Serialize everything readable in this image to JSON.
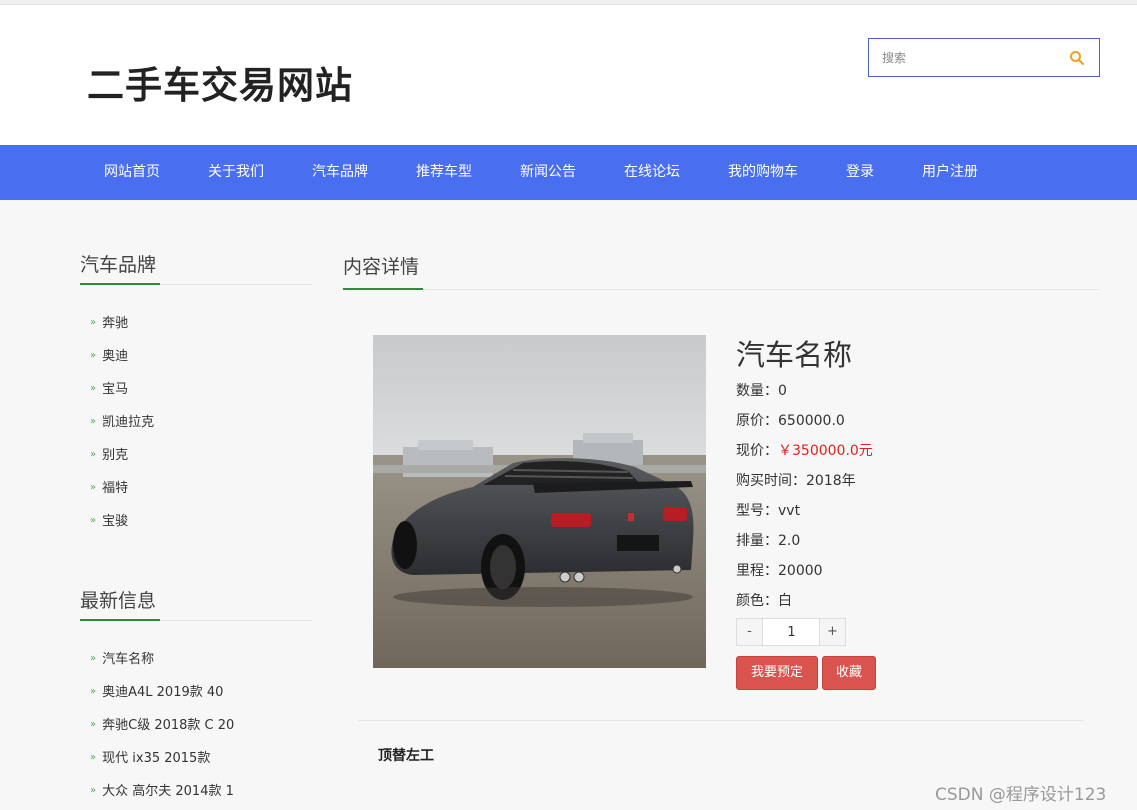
{
  "site": {
    "title": "二手车交易网站"
  },
  "search": {
    "placeholder": "搜索",
    "icon": "search-icon"
  },
  "nav": {
    "items": [
      {
        "label": "网站首页"
      },
      {
        "label": "关于我们"
      },
      {
        "label": "汽车品牌"
      },
      {
        "label": "推荐车型"
      },
      {
        "label": "新闻公告"
      },
      {
        "label": "在线论坛"
      },
      {
        "label": "我的购物车"
      },
      {
        "label": "登录"
      },
      {
        "label": "用户注册"
      }
    ]
  },
  "sidebar": {
    "brands": {
      "title": "汽车品牌",
      "items": [
        {
          "label": "奔驰"
        },
        {
          "label": "奥迪"
        },
        {
          "label": "宝马"
        },
        {
          "label": "凯迪拉克"
        },
        {
          "label": "别克"
        },
        {
          "label": "福特"
        },
        {
          "label": "宝骏"
        }
      ]
    },
    "latest": {
      "title": "最新信息",
      "items": [
        {
          "label": "汽车名称"
        },
        {
          "label": "奥迪A4L 2019款 40"
        },
        {
          "label": "奔驰C级 2018款 C 20"
        },
        {
          "label": "现代 ix35 2015款"
        },
        {
          "label": "大众 高尔夫 2014款 1"
        }
      ]
    }
  },
  "main": {
    "title": "内容详情",
    "car": {
      "name": "汽车名称",
      "fields": [
        {
          "label": "数量：",
          "value": "0"
        },
        {
          "label": "原价：",
          "value": "650000.0"
        },
        {
          "label": "现价：",
          "value": "￥350000.0元"
        },
        {
          "label": "购买时间：",
          "value": "2018年"
        },
        {
          "label": "型号：",
          "value": "vvt"
        },
        {
          "label": "排量：",
          "value": "2.0"
        },
        {
          "label": "里程：",
          "value": "20000"
        },
        {
          "label": "颜色：",
          "value": "白"
        }
      ]
    },
    "quantity": {
      "minus": "-",
      "value": "1",
      "plus": "+"
    },
    "buttons": {
      "reserve": "我要预定",
      "favorite": "收藏"
    },
    "detail_text": "顶替左工"
  },
  "watermark": "CSDN @程序设计123",
  "colors": {
    "nav_bg": "#4a6ef0",
    "accent_green": "#2e8b3a",
    "button_red": "#d9534f",
    "price_red": "#e02020",
    "search_icon": "#f0a020"
  }
}
